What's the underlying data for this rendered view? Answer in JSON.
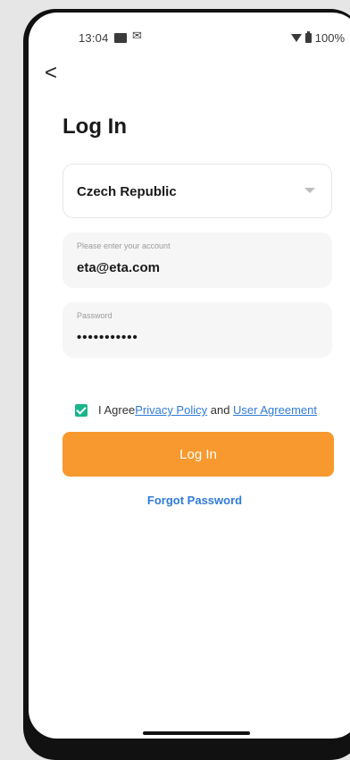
{
  "status_bar": {
    "time": "13:04",
    "mail_icon": "mail-icon",
    "battery_text": "100%"
  },
  "header": {
    "back_icon": "chevron-left-icon",
    "title": "Log In"
  },
  "form": {
    "country": {
      "value": "Czech Republic",
      "icon": "caret-down-icon"
    },
    "account": {
      "placeholder": "Please enter your account",
      "value": "eta@eta.com"
    },
    "password": {
      "placeholder": "Password",
      "value": "•••••••••••"
    },
    "agreement": {
      "checked": true,
      "prefix": "I Agree",
      "privacy_link": "Privacy Policy",
      "and_text": " and ",
      "user_agreement_link": "User Agreement"
    },
    "login_button": "Log In",
    "forgot_password": "Forgot Password"
  },
  "colors": {
    "accent": "#f7992e",
    "link": "#2f7bd6",
    "checkbox": "#19b58c"
  }
}
